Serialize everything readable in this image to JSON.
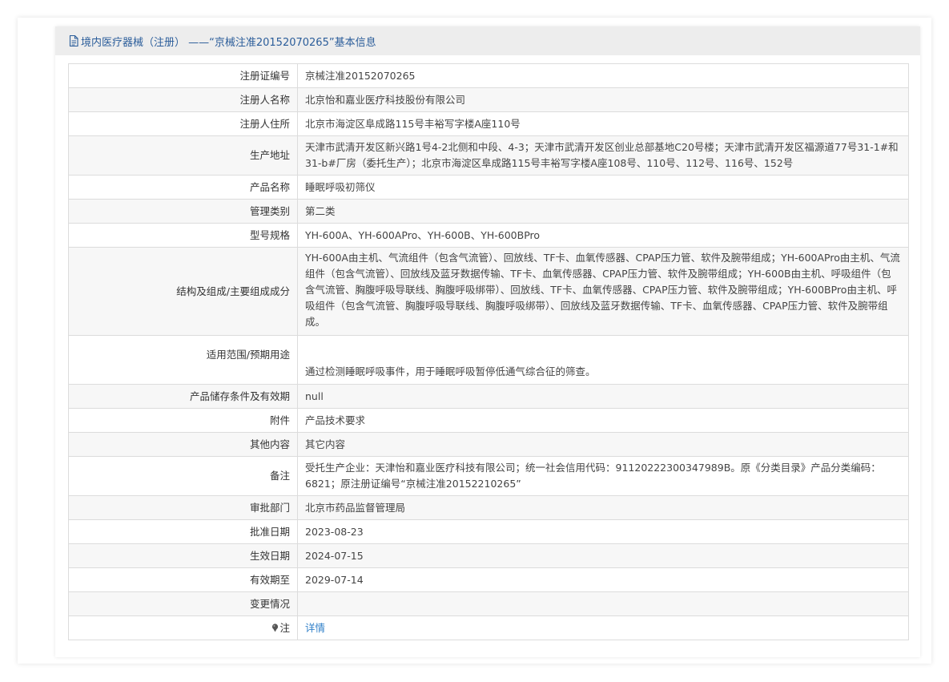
{
  "header": {
    "title": "境内医疗器械（注册） ——“京械注准20152070265”基本信息"
  },
  "rows": [
    {
      "label": "注册证编号",
      "value": "京械注准20152070265"
    },
    {
      "label": "注册人名称",
      "value": "北京怡和嘉业医疗科技股份有限公司"
    },
    {
      "label": "注册人住所",
      "value": "北京市海淀区阜成路115号丰裕写字楼A座110号"
    },
    {
      "label": "生产地址",
      "value": "天津市武清开发区新兴路1号4-2北侧和中段、4-3；天津市武清开发区创业总部基地C20号楼；天津市武清开发区福源道77号31-1#和31-b#厂房（委托生产）；北京市海淀区阜成路115号丰裕写字楼A座108号、110号、112号、116号、152号"
    },
    {
      "label": "产品名称",
      "value": "睡眠呼吸初筛仪"
    },
    {
      "label": "管理类别",
      "value": "第二类"
    },
    {
      "label": "型号规格",
      "value": "YH-600A、YH-600APro、YH-600B、YH-600BPro"
    },
    {
      "label": "结构及组成/主要组成成分",
      "value": "YH-600A由主机、气流组件（包含气流管）、回放线、TF卡、血氧传感器、CPAP压力管、软件及腕带组成；YH-600APro由主机、气流组件（包含气流管）、回放线及蓝牙数据传输、TF卡、血氧传感器、CPAP压力管、软件及腕带组成；YH-600B由主机、呼吸组件（包含气流管、胸腹呼吸导联线、胸腹呼吸绑带）、回放线、TF卡、血氧传感器、CPAP压力管、软件及腕带组成；YH-600BPro由主机、呼吸组件（包含气流管、胸腹呼吸导联线、胸腹呼吸绑带）、回放线及蓝牙数据传输、TF卡、血氧传感器、CPAP压力管、软件及腕带组成。"
    },
    {
      "label": "适用范围/预期用途",
      "value": "通过检测睡眠呼吸事件，用于睡眠呼吸暂停低通气综合征的筛查。"
    },
    {
      "label": "产品储存条件及有效期",
      "value": "null"
    },
    {
      "label": "附件",
      "value": "产品技术要求"
    },
    {
      "label": "其他内容",
      "value": "其它内容"
    },
    {
      "label": "备注",
      "value": "受托生产企业：天津怡和嘉业医疗科技有限公司；统一社会信用代码：91120222300347989B。原《分类目录》产品分类编码：6821；原注册证编号“京械注准20152210265”"
    },
    {
      "label": "审批部门",
      "value": "北京市药品监督管理局"
    },
    {
      "label": "批准日期",
      "value": "2023-08-23"
    },
    {
      "label": "生效日期",
      "value": "2024-07-15"
    },
    {
      "label": "有效期至",
      "value": "2029-07-14"
    },
    {
      "label": "变更情况",
      "value": ""
    }
  ],
  "note_row": {
    "label": "注",
    "link_text": "详情"
  }
}
